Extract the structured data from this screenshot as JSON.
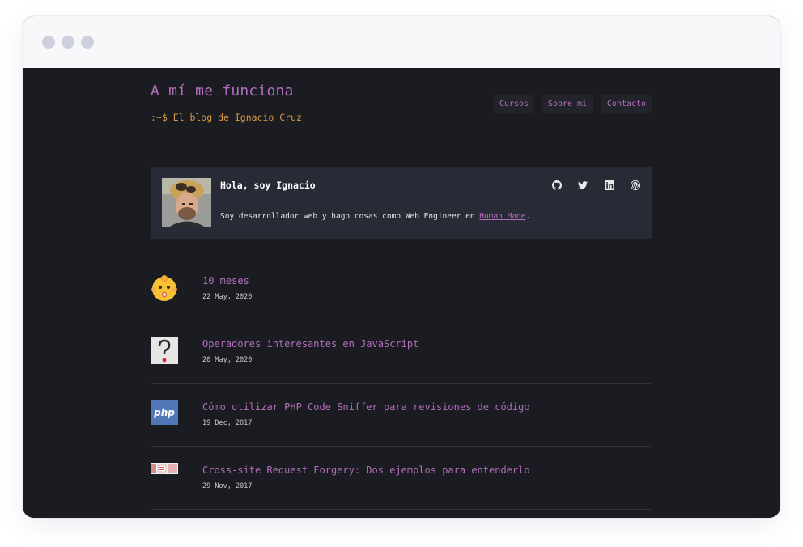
{
  "site": {
    "title": "A mí me funciona",
    "tagline": ":~$ El blog de Ignacio Cruz"
  },
  "nav": {
    "items": [
      "Cursos",
      "Sobre mí",
      "Contacto"
    ]
  },
  "bio": {
    "greeting": "Hola, soy Ignacio",
    "description_prefix": "Soy desarrollador web y hago cosas como Web Engineer en ",
    "link_text": "Human Made",
    "description_suffix": ".",
    "social_icons": [
      "github-icon",
      "twitter-icon",
      "linkedin-icon",
      "wordpress-icon"
    ]
  },
  "posts": [
    {
      "title": "10 meses",
      "date": "22 May, 2020",
      "icon": "baby-face-icon"
    },
    {
      "title": "Operadores interesantes en JavaScript",
      "date": "20 May, 2020",
      "icon": "question-mark-icon"
    },
    {
      "title": "Cómo utilizar PHP Code Sniffer para revisiones de código",
      "date": "19 Dec, 2017",
      "icon": "php-logo-icon",
      "icon_text": "php"
    },
    {
      "title": "Cross-site Request Forgery: Dos ejemplos para entenderlo",
      "date": "29 Nov, 2017",
      "icon": "csrf-thumbnail-icon"
    }
  ],
  "colors": {
    "background": "#1b1c21",
    "accent": "#b36ebd",
    "tagline": "#d89a42",
    "card": "#282b36"
  }
}
